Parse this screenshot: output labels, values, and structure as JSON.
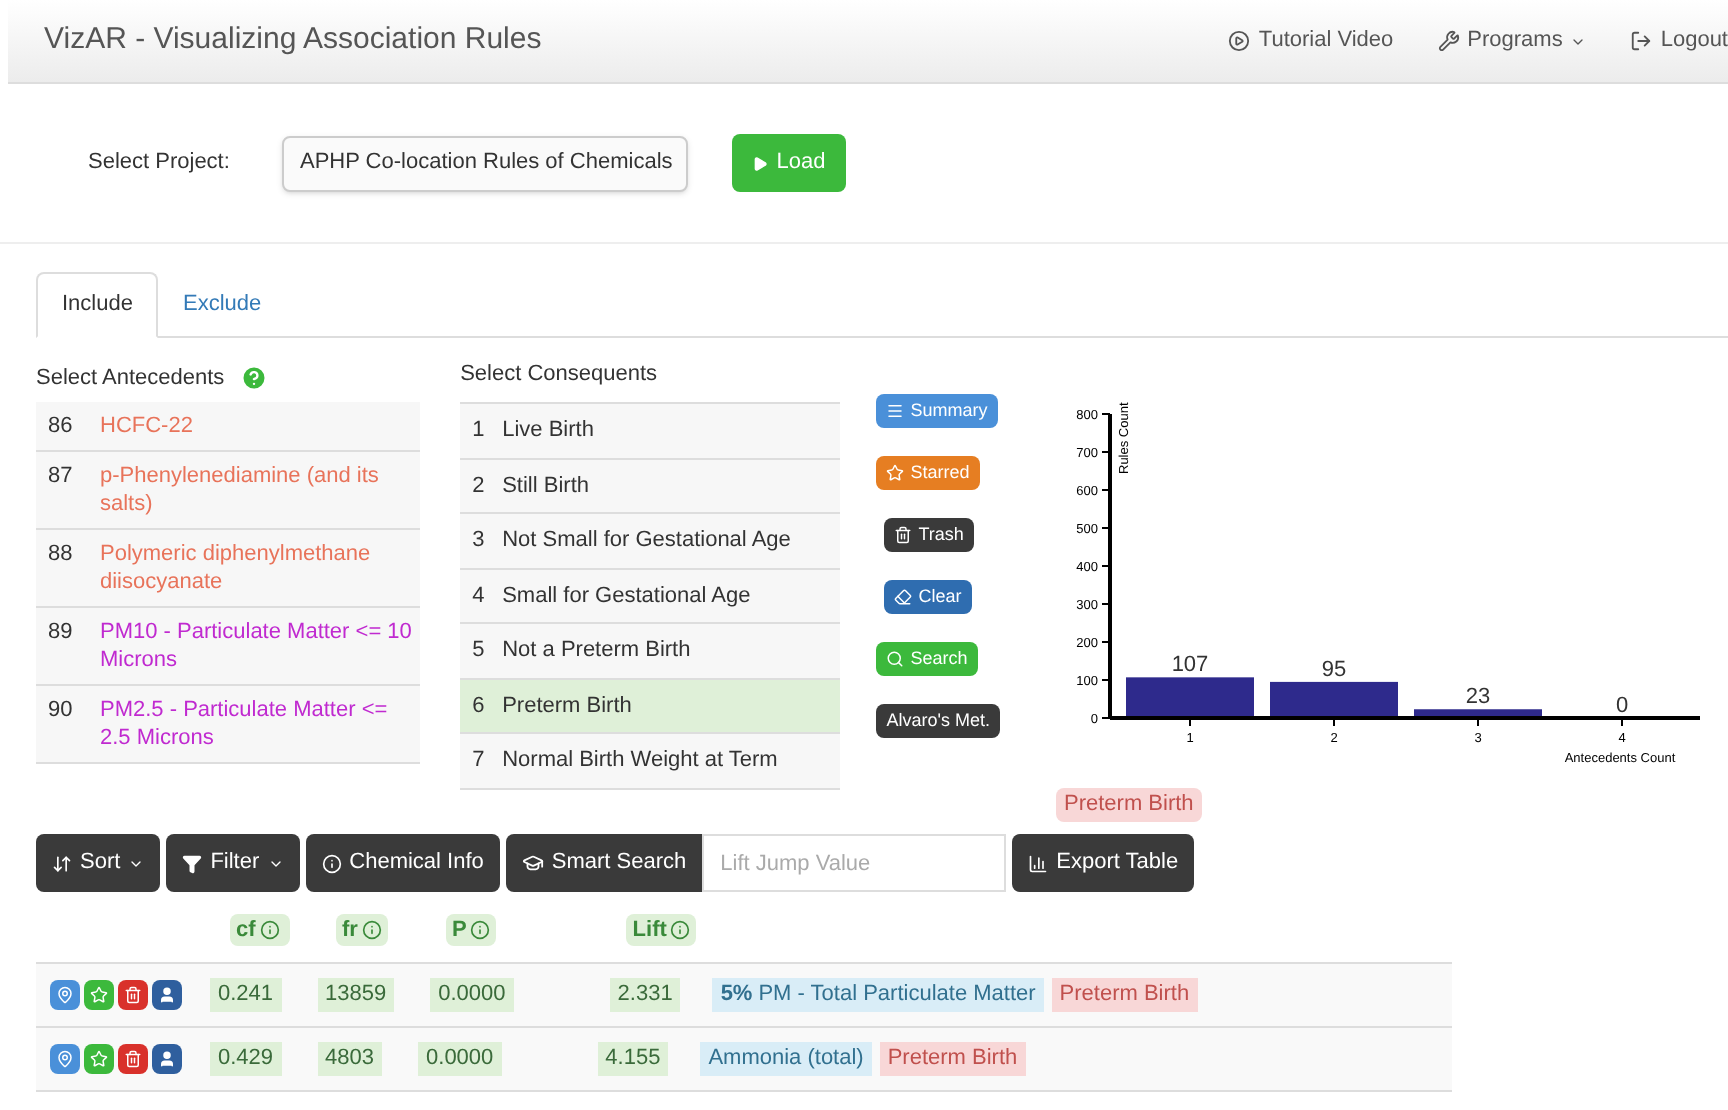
{
  "navbar": {
    "brand": "VizAR - Visualizing Association Rules",
    "links": [
      {
        "kind": "video",
        "label": "Tutorial Video"
      },
      {
        "kind": "programs",
        "label": "Programs"
      },
      {
        "kind": "logout",
        "label": "Logout"
      }
    ]
  },
  "project": {
    "label": "Select Project:",
    "value": "APHP Co-location Rules of Chemicals",
    "load": "Load"
  },
  "tabs": [
    {
      "label": "Include",
      "selected": true
    },
    {
      "label": "Exclude",
      "selected": false
    }
  ],
  "antecedents": {
    "title": "Select Antecedents",
    "items": [
      {
        "num": "86",
        "name": "HCFC-22",
        "color": "#e8735a"
      },
      {
        "num": "87",
        "name": "p-Phenylenediamine (and its salts)",
        "color": "#e8735a"
      },
      {
        "num": "88",
        "name": "Polymeric diphenylmethane diisocyanate",
        "color": "#e8735a"
      },
      {
        "num": "89",
        "name": "PM10 - Particulate Matter <= 10 Microns",
        "color": "#c02ad0"
      },
      {
        "num": "90",
        "name": "PM2.5 - Particulate Matter <= 2.5 Microns",
        "color": "#c02ad0"
      }
    ]
  },
  "consequents": {
    "title": "Select Consequents",
    "items": [
      {
        "num": "1",
        "name": "Live Birth",
        "selected": false
      },
      {
        "num": "2",
        "name": "Still Birth",
        "selected": false
      },
      {
        "num": "3",
        "name": "Not Small for Gestational Age",
        "selected": false
      },
      {
        "num": "4",
        "name": "Small for Gestational Age",
        "selected": false
      },
      {
        "num": "5",
        "name": "Not a Preterm Birth",
        "selected": false
      },
      {
        "num": "6",
        "name": "Preterm Birth",
        "selected": true
      },
      {
        "num": "7",
        "name": "Normal Birth Weight at Term",
        "selected": false
      }
    ]
  },
  "actions": [
    {
      "kind": "summary",
      "label": "Summary"
    },
    {
      "kind": "starred",
      "label": "Starred"
    },
    {
      "kind": "trash",
      "label": "Trash"
    },
    {
      "kind": "clear",
      "label": "Clear"
    },
    {
      "kind": "search",
      "label": "Search"
    },
    {
      "kind": "metric",
      "label": "Alvaro's Met."
    }
  ],
  "chart": {
    "chart_data": {
      "type": "bar",
      "xlabel": "Antecedents Count",
      "ylabel": "Rules Count",
      "categories": [
        "1",
        "2",
        "3",
        "4"
      ],
      "values": [
        107,
        95,
        23,
        0
      ],
      "ylim": [
        0,
        800
      ],
      "yticks": [
        0,
        100,
        200,
        300,
        400,
        500,
        600,
        700,
        800
      ],
      "data_labels": true
    }
  },
  "selected_consequent": "Preterm Birth",
  "toolbar": {
    "sort": "Sort",
    "filter": "Filter",
    "chemical_info": "Chemical Info",
    "smart_search": "Smart Search",
    "lift_placeholder": "Lift Jump Value",
    "export": "Export Table"
  },
  "table": {
    "columns": [
      "cf",
      "fr",
      "P",
      "Lift"
    ],
    "rows": [
      {
        "cf": "0.241",
        "fr": "13859",
        "p": "0.0000",
        "lift": "2.331",
        "antecedent_prefix": "5%",
        "antecedent": "PM - Total Particulate Matter",
        "consequent": "Preterm Birth"
      },
      {
        "cf": "0.429",
        "fr": "4803",
        "p": "0.0000",
        "lift": "4.155",
        "antecedent": "Ammonia (total)",
        "consequent": "Preterm Birth"
      }
    ]
  }
}
